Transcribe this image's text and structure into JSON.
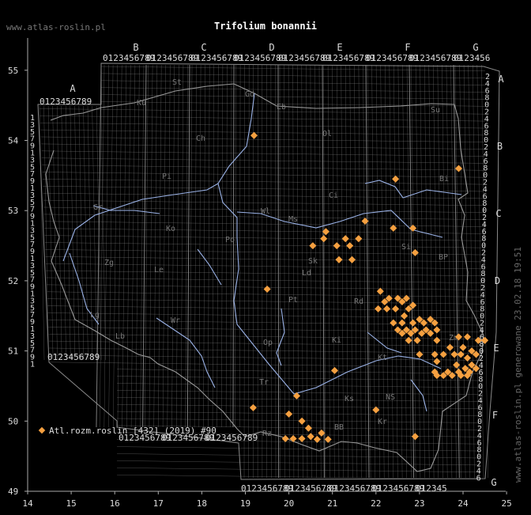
{
  "site_label": "www.atlas-roslin.pl",
  "title": "Trifolium bonannii",
  "legend": {
    "text": "Atl.rozm.roslin [432] (2019) #90",
    "color": "#f5a040"
  },
  "side_text": "www.atlas-roslin.pl generowane 23.02.18 19:51",
  "colors": {
    "background": "#000000",
    "grid": "#8a8a8a",
    "river": "#9bb3e8",
    "border": "#999999",
    "point": "#f5a040",
    "text": "#ffffff"
  },
  "axes": {
    "x_ticks": [
      "14",
      "15",
      "16",
      "17",
      "18",
      "19",
      "20",
      "21",
      "22",
      "23",
      "24",
      "25"
    ],
    "y_ticks": [
      "49",
      "50",
      "51",
      "52",
      "53",
      "54",
      "55"
    ]
  },
  "square_labels": {
    "top_letters": [
      "B",
      "C",
      "D",
      "E",
      "F",
      "G"
    ],
    "top_digits": "0123456789",
    "left_letter": "A",
    "right_letters": [
      "A",
      "B",
      "C",
      "D",
      "E",
      "F",
      "G"
    ],
    "left_digits": [
      "1",
      "3",
      "5",
      "7",
      "9"
    ],
    "right_digits": [
      "2",
      "4",
      "6",
      "8",
      "0"
    ],
    "bottom_digits": "0123456789"
  },
  "region_codes": [
    "Ku",
    "St",
    "Gd",
    "Eb",
    "Su",
    "Ch",
    "Ol",
    "Bi",
    "Pi",
    "Ci",
    "Gr",
    "Ko",
    "Wl",
    "Ms",
    "Po",
    "Sk",
    "Si",
    "Zg",
    "Le",
    "Ld",
    "BP",
    "Pt",
    "Rd",
    "Lg",
    "Wr",
    "Lb",
    "Ki",
    "Zm",
    "Op",
    "Kt",
    "Tr",
    "Ks",
    "NS",
    "BB",
    "Rz",
    "Kr"
  ],
  "chart_data": {
    "type": "scatter",
    "title": "Trifolium bonannii",
    "xlabel": "",
    "ylabel": "",
    "xlim": [
      14,
      25
    ],
    "ylim": [
      49,
      55.5
    ],
    "series": [
      {
        "name": "Atl.rozm.roslin [432] (2019) #90",
        "points": [
          [
            19.2,
            54.07
          ],
          [
            22.45,
            53.45
          ],
          [
            23.9,
            53.6
          ],
          [
            21.75,
            52.85
          ],
          [
            22.4,
            52.75
          ],
          [
            22.85,
            52.75
          ],
          [
            20.85,
            52.7
          ],
          [
            20.8,
            52.6
          ],
          [
            21.3,
            52.6
          ],
          [
            21.6,
            52.6
          ],
          [
            20.55,
            52.5
          ],
          [
            21.1,
            52.5
          ],
          [
            21.4,
            52.5
          ],
          [
            22.9,
            52.4
          ],
          [
            21.15,
            52.3
          ],
          [
            21.45,
            52.3
          ],
          [
            19.5,
            51.88
          ],
          [
            22.1,
            51.85
          ],
          [
            22.3,
            51.75
          ],
          [
            22.5,
            51.75
          ],
          [
            22.7,
            51.75
          ],
          [
            22.2,
            51.7
          ],
          [
            22.6,
            51.7
          ],
          [
            22.85,
            51.65
          ],
          [
            22.05,
            51.6
          ],
          [
            22.25,
            51.6
          ],
          [
            22.45,
            51.6
          ],
          [
            22.75,
            51.6
          ],
          [
            22.65,
            51.5
          ],
          [
            23.0,
            51.45
          ],
          [
            23.25,
            51.45
          ],
          [
            22.4,
            51.4
          ],
          [
            22.6,
            51.4
          ],
          [
            22.85,
            51.4
          ],
          [
            23.1,
            51.4
          ],
          [
            23.35,
            51.4
          ],
          [
            22.5,
            51.3
          ],
          [
            22.7,
            51.3
          ],
          [
            22.9,
            51.3
          ],
          [
            23.15,
            51.3
          ],
          [
            23.4,
            51.3
          ],
          [
            22.6,
            51.25
          ],
          [
            22.8,
            51.25
          ],
          [
            23.05,
            51.25
          ],
          [
            23.25,
            51.25
          ],
          [
            22.75,
            51.15
          ],
          [
            22.95,
            51.15
          ],
          [
            23.4,
            51.15
          ],
          [
            23.9,
            51.2
          ],
          [
            24.1,
            51.2
          ],
          [
            24.35,
            51.15
          ],
          [
            24.5,
            51.15
          ],
          [
            23.7,
            51.05
          ],
          [
            24.0,
            51.05
          ],
          [
            24.2,
            51.0
          ],
          [
            23.35,
            50.95
          ],
          [
            23.55,
            50.95
          ],
          [
            23.8,
            50.95
          ],
          [
            23.95,
            50.95
          ],
          [
            24.1,
            50.9
          ],
          [
            24.3,
            50.95
          ],
          [
            24.2,
            50.8
          ],
          [
            23.4,
            50.85
          ],
          [
            23.85,
            50.8
          ],
          [
            24.05,
            50.75
          ],
          [
            23.35,
            50.7
          ],
          [
            23.65,
            50.7
          ],
          [
            23.9,
            50.7
          ],
          [
            24.15,
            50.7
          ],
          [
            24.3,
            50.75
          ],
          [
            23.4,
            50.65
          ],
          [
            23.55,
            50.65
          ],
          [
            23.75,
            50.65
          ],
          [
            23.95,
            50.65
          ],
          [
            24.1,
            50.65
          ],
          [
            23.0,
            50.95
          ],
          [
            21.05,
            50.72
          ],
          [
            20.18,
            50.36
          ],
          [
            19.18,
            50.19
          ],
          [
            22.0,
            50.16
          ],
          [
            20.0,
            50.1
          ],
          [
            20.3,
            50.0
          ],
          [
            20.45,
            49.9
          ],
          [
            20.75,
            49.83
          ],
          [
            20.5,
            49.78
          ],
          [
            20.3,
            49.75
          ],
          [
            20.1,
            49.75
          ],
          [
            19.92,
            49.75
          ],
          [
            20.65,
            49.74
          ],
          [
            20.9,
            49.74
          ],
          [
            22.9,
            49.78
          ]
        ]
      }
    ]
  }
}
